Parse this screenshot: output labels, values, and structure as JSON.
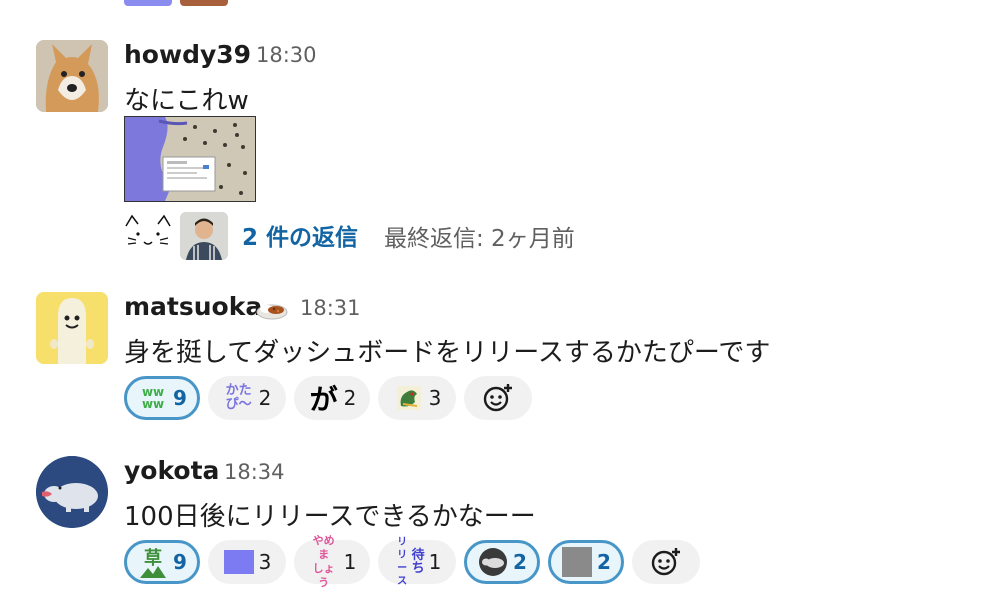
{
  "messages": [
    {
      "user": "howdy39",
      "time": "18:30",
      "text": "なにこれw",
      "thread": {
        "replies_label": "2 件の返信",
        "last_reply": "最終返信: 2ヶ月前"
      }
    },
    {
      "user": "matsuoka",
      "user_emoji": "curry-rice-icon",
      "time": "18:31",
      "text": "身を挺してダッシュボードをリリースするかたぴーです",
      "reactions": [
        {
          "icon": "wwww-icon",
          "glyph": "ww\nww",
          "count": "9",
          "selected": true
        },
        {
          "icon": "katapi-icon",
          "glyph": "かた\nぴ〜",
          "count": "2",
          "selected": false
        },
        {
          "icon": "ga-icon",
          "glyph": "が",
          "count": "2",
          "selected": false
        },
        {
          "icon": "dragon-icon",
          "glyph": "🐉",
          "count": "3",
          "selected": false
        }
      ]
    },
    {
      "user": "yokota",
      "time": "18:34",
      "text": "100日後にリリースできるかなーー",
      "reactions": [
        {
          "icon": "kusa-icon",
          "glyph": "草",
          "count": "9",
          "selected": true
        },
        {
          "icon": "purple-square-icon",
          "glyph": "",
          "count": "3",
          "selected": false
        },
        {
          "icon": "yamemashou-icon",
          "glyph": "やめま\nしょう",
          "count": "1",
          "selected": false
        },
        {
          "icon": "release-machi-icon",
          "glyph": "リリース\n待ち",
          "count": "1",
          "selected": false
        },
        {
          "icon": "hippo-circle-icon",
          "glyph": "",
          "count": "2",
          "selected": true
        },
        {
          "icon": "gray-square-icon",
          "glyph": "",
          "count": "2",
          "selected": true
        }
      ]
    }
  ],
  "colors": {
    "link": "#1264a3",
    "selected_border": "#4796c7",
    "pill_bg": "#f1f1f1"
  }
}
